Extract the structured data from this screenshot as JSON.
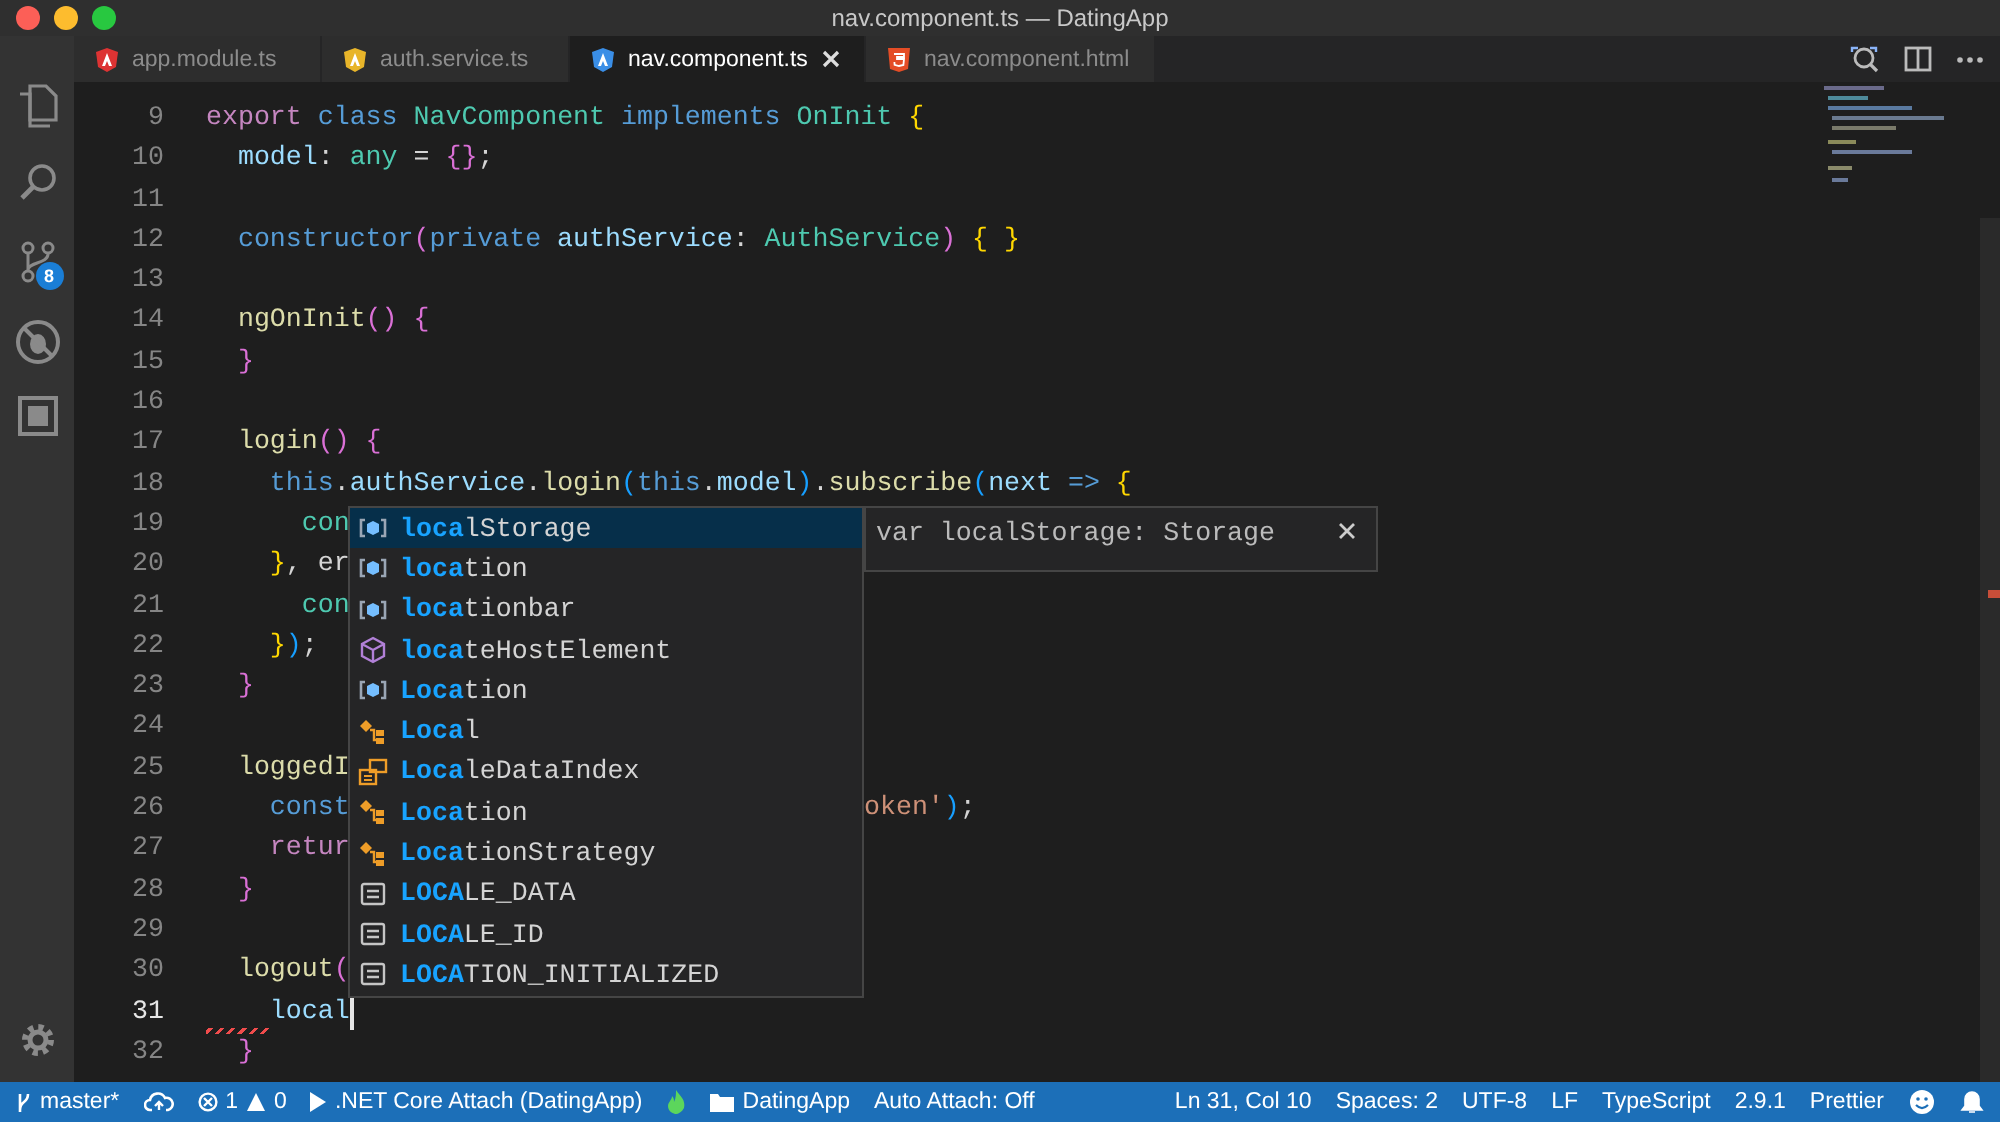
{
  "window": {
    "title": "nav.component.ts — DatingApp"
  },
  "activity_bar": {
    "items": [
      {
        "kind": "files"
      },
      {
        "kind": "search"
      },
      {
        "kind": "scm",
        "badge": "8"
      },
      {
        "kind": "debug"
      },
      {
        "kind": "extensions"
      }
    ]
  },
  "tabs": [
    {
      "label": "app.module.ts",
      "kind": "angular",
      "color": "#dd3333",
      "selected": false
    },
    {
      "label": "auth.service.ts",
      "kind": "angular",
      "color": "#e8b52a",
      "selected": false
    },
    {
      "label": "nav.component.ts",
      "kind": "angular",
      "color": "#3a8ee6",
      "selected": true
    },
    {
      "label": "nav.component.html",
      "kind": "html",
      "color": "#e44d26",
      "selected": false
    }
  ],
  "editor": {
    "lines": [
      {
        "number": "9",
        "tokens": [
          {
            "text": "export",
            "kind": "ctl"
          },
          {
            "text": " class",
            "kind": "kw"
          },
          {
            "text": " NavComponent",
            "kind": "type"
          },
          {
            "text": " implements",
            "kind": "kw"
          },
          {
            "text": " OnInit",
            "kind": "type"
          },
          {
            "text": " {",
            "kind": "b1"
          }
        ]
      },
      {
        "number": "10",
        "tokens": [
          {
            "text": "  model",
            "kind": "var"
          },
          {
            "text": ":",
            "kind": "punc"
          },
          {
            "text": " any",
            "kind": "type"
          },
          {
            "text": " =",
            "kind": "punc"
          },
          {
            "text": " {}",
            "kind": "b2"
          },
          {
            "text": ";",
            "kind": "punc"
          }
        ]
      },
      {
        "number": "11"
      },
      {
        "number": "12",
        "tokens": [
          {
            "text": "  constructor",
            "kind": "kw"
          },
          {
            "text": "(",
            "kind": "b2"
          },
          {
            "text": "private",
            "kind": "kw"
          },
          {
            "text": " authService",
            "kind": "var"
          },
          {
            "text": ":",
            "kind": "punc"
          },
          {
            "text": " AuthService",
            "kind": "type"
          },
          {
            "text": ")",
            "kind": "b2"
          },
          {
            "text": " { }",
            "kind": "b1"
          }
        ]
      },
      {
        "number": "13"
      },
      {
        "number": "14",
        "tokens": [
          {
            "text": "  ngOnInit",
            "kind": "fn"
          },
          {
            "text": "()",
            "kind": "b2"
          },
          {
            "text": " {",
            "kind": "b2"
          }
        ]
      },
      {
        "number": "15",
        "tokens": [
          {
            "text": "  }",
            "kind": "b2"
          }
        ]
      },
      {
        "number": "16"
      },
      {
        "number": "17",
        "tokens": [
          {
            "text": "  login",
            "kind": "fn"
          },
          {
            "text": "()",
            "kind": "b2"
          },
          {
            "text": " {",
            "kind": "b2"
          }
        ]
      },
      {
        "number": "18",
        "tokens": [
          {
            "text": "    this",
            "kind": "kw"
          },
          {
            "text": ".",
            "kind": "punc"
          },
          {
            "text": "authService",
            "kind": "var"
          },
          {
            "text": ".",
            "kind": "punc"
          },
          {
            "text": "login",
            "kind": "fn"
          },
          {
            "text": "(",
            "kind": "b3"
          },
          {
            "text": "this",
            "kind": "kw"
          },
          {
            "text": ".",
            "kind": "punc"
          },
          {
            "text": "model",
            "kind": "var"
          },
          {
            "text": ")",
            "kind": "b3"
          },
          {
            "text": ".",
            "kind": "punc"
          },
          {
            "text": "subscribe",
            "kind": "fn"
          },
          {
            "text": "(",
            "kind": "b3"
          },
          {
            "text": "next",
            "kind": "var"
          },
          {
            "text": " =>",
            "kind": "kw"
          },
          {
            "text": " {",
            "kind": "b1"
          }
        ]
      },
      {
        "number": "19",
        "tokens": [
          {
            "text": "      con",
            "kind": "type"
          }
        ]
      },
      {
        "number": "20",
        "tokens": [
          {
            "text": "    }",
            "kind": "b1"
          },
          {
            "text": ", er",
            "kind": "punc"
          }
        ]
      },
      {
        "number": "21",
        "tokens": [
          {
            "text": "      con",
            "kind": "type"
          }
        ]
      },
      {
        "number": "22",
        "tokens": [
          {
            "text": "    }",
            "kind": "b1"
          },
          {
            "text": ")",
            "kind": "b3"
          },
          {
            "text": ";",
            "kind": "punc"
          }
        ]
      },
      {
        "number": "23",
        "tokens": [
          {
            "text": "  }",
            "kind": "b2"
          }
        ]
      },
      {
        "number": "24"
      },
      {
        "number": "25",
        "tokens": [
          {
            "text": "  loggedI",
            "kind": "fn"
          }
        ]
      },
      {
        "number": "26",
        "tokens": [
          {
            "text": "    const",
            "kind": "kw"
          },
          {
            "text": "oken'",
            "kind": "str",
            "after": true
          },
          {
            "text": ")",
            "kind": "b3",
            "after": true
          },
          {
            "text": ";",
            "kind": "punc",
            "after": true
          }
        ]
      },
      {
        "number": "27",
        "tokens": [
          {
            "text": "    retur",
            "kind": "ctl"
          }
        ]
      },
      {
        "number": "28",
        "tokens": [
          {
            "text": "  }",
            "kind": "b2"
          }
        ]
      },
      {
        "number": "29"
      },
      {
        "number": "30",
        "tokens": [
          {
            "text": "  logout",
            "kind": "fn"
          },
          {
            "text": "(",
            "kind": "b2"
          }
        ]
      },
      {
        "number": "31",
        "current": true,
        "squiggle": true,
        "tokens": [
          {
            "text": "    local",
            "kind": "var"
          }
        ]
      },
      {
        "number": "32",
        "tokens": [
          {
            "text": "  }",
            "kind": "b2"
          }
        ]
      }
    ]
  },
  "suggestions": {
    "items": [
      {
        "kind": "variable",
        "match": "loca",
        "rest": "lStorage",
        "selected": true
      },
      {
        "kind": "variable",
        "match": "loca",
        "rest": "tion",
        "selected": false
      },
      {
        "kind": "variable",
        "match": "loca",
        "rest": "tionbar",
        "selected": false
      },
      {
        "kind": "module",
        "match": "loca",
        "rest": "teHostElement",
        "selected": false
      },
      {
        "kind": "variable",
        "match": "Loca",
        "rest": "tion",
        "selected": false
      },
      {
        "kind": "class",
        "match": "Loca",
        "rest": "l",
        "selected": false
      },
      {
        "kind": "enum",
        "match": "Loca",
        "rest": "leDataIndex",
        "selected": false
      },
      {
        "kind": "class",
        "match": "Loca",
        "rest": "tion",
        "selected": false
      },
      {
        "kind": "class",
        "match": "Loca",
        "rest": "tionStrategy",
        "selected": false
      },
      {
        "kind": "constant",
        "match": "LOCA",
        "rest": "LE_DATA",
        "selected": false
      },
      {
        "kind": "constant",
        "match": "LOCA",
        "rest": "LE_ID",
        "selected": false
      },
      {
        "kind": "constant",
        "match": "LOCA",
        "rest": "TION_INITIALIZED",
        "selected": false
      }
    ],
    "detail": "var localStorage: Storage"
  },
  "status_bar": {
    "left": [
      {
        "kind": "branch",
        "text": "master*"
      },
      {
        "kind": "sync"
      },
      {
        "kind": "problems",
        "errors": "1",
        "warnings": "0"
      },
      {
        "kind": "debug",
        "text": ".NET Core Attach (DatingApp)"
      },
      {
        "kind": "flame"
      },
      {
        "kind": "folder",
        "text": "DatingApp"
      },
      {
        "kind": "text",
        "text": "Auto Attach: Off"
      }
    ],
    "right": [
      {
        "kind": "text",
        "text": "Ln 31, Col 10"
      },
      {
        "kind": "text",
        "text": "Spaces: 2"
      },
      {
        "kind": "text",
        "text": "UTF-8"
      },
      {
        "kind": "text",
        "text": "LF"
      },
      {
        "kind": "text",
        "text": "TypeScript"
      },
      {
        "kind": "text",
        "text": "2.9.1"
      },
      {
        "kind": "text",
        "text": "Prettier"
      },
      {
        "kind": "smiley"
      },
      {
        "kind": "bell"
      }
    ]
  }
}
